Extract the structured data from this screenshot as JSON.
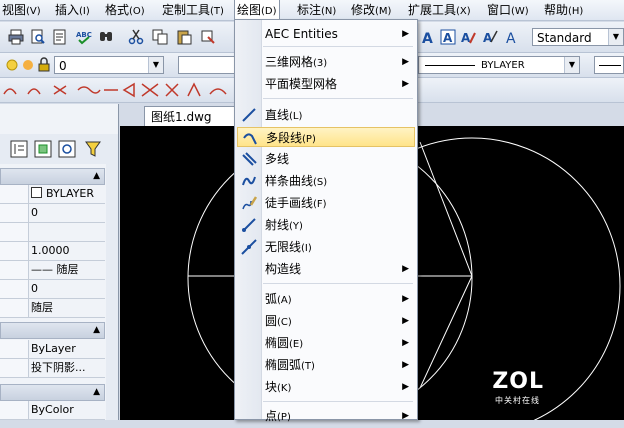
{
  "menubar": {
    "items": [
      {
        "label": "视图",
        "hk": "(V)"
      },
      {
        "label": "插入",
        "hk": "(I)"
      },
      {
        "label": "格式",
        "hk": "(O)"
      },
      {
        "label": "定制工具",
        "hk": "(T)"
      },
      {
        "label": "绘图",
        "hk": "(D)"
      },
      {
        "label": "标注",
        "hk": "(N)"
      },
      {
        "label": "修改",
        "hk": "(M)"
      },
      {
        "label": "扩展工具",
        "hk": "(X)"
      },
      {
        "label": "窗口",
        "hk": "(W)"
      },
      {
        "label": "帮助",
        "hk": "(H)"
      }
    ]
  },
  "toolbar": {
    "textstyle_value": "Standard",
    "layer_value": "0",
    "linetype_value": "BYLAYER"
  },
  "drawing_tab": {
    "label": "图纸1.dwg",
    "close": "✕"
  },
  "properties": {
    "color_value": "BYLAYER",
    "layer_value": "0",
    "linetype_scale": "1.0000",
    "lineweight": "—— 随层",
    "thickness": "0",
    "plotstyle": "随层",
    "material": "ByLayer",
    "shadow": "投下阴影...",
    "plot_color": "ByColor"
  },
  "draw_menu": {
    "items": [
      {
        "label": "AEC Entities",
        "hk": "",
        "submenu": true
      },
      {
        "label": "三维网格",
        "hk": "(3)",
        "submenu": true
      },
      {
        "label": "平面模型网格",
        "hk": "",
        "submenu": true
      },
      {
        "label": "直线",
        "hk": "(L)",
        "submenu": false
      },
      {
        "label": "多段线",
        "hk": "(P)",
        "submenu": false
      },
      {
        "label": "多线",
        "hk": "",
        "submenu": false
      },
      {
        "label": "样条曲线",
        "hk": "(S)",
        "submenu": false
      },
      {
        "label": "徒手画线",
        "hk": "(F)",
        "submenu": false
      },
      {
        "label": "射线",
        "hk": "(Y)",
        "submenu": false
      },
      {
        "label": "无限线",
        "hk": "(I)",
        "submenu": false
      },
      {
        "label": "构造线",
        "hk": "",
        "submenu": true
      },
      {
        "label": "弧",
        "hk": "(A)",
        "submenu": true
      },
      {
        "label": "圆",
        "hk": "(C)",
        "submenu": true
      },
      {
        "label": "椭圆",
        "hk": "(E)",
        "submenu": true
      },
      {
        "label": "椭圆弧",
        "hk": "(T)",
        "submenu": true
      },
      {
        "label": "块",
        "hk": "(K)",
        "submenu": true
      },
      {
        "label": "点",
        "hk": "(P)",
        "submenu": true
      }
    ]
  },
  "watermark": {
    "brand": "ZOL",
    "sub": "中关村在线"
  },
  "colors": {
    "accent": "#ffe48a",
    "canvas": "#000000"
  }
}
